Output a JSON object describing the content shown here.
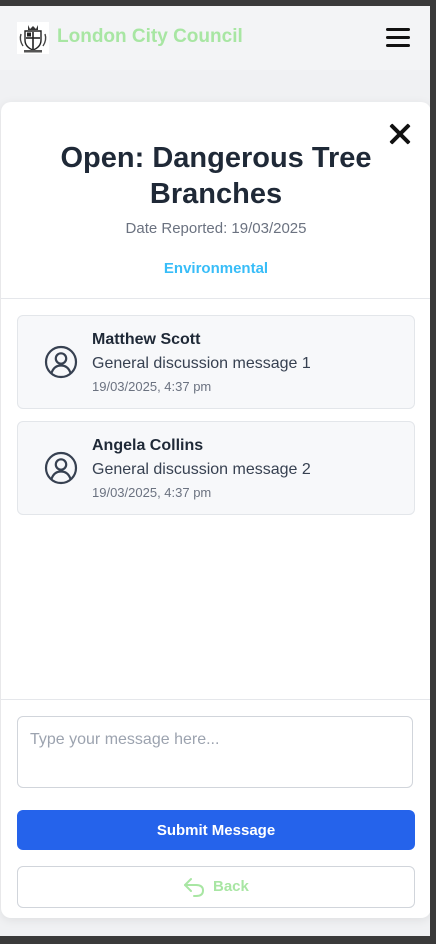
{
  "header": {
    "brand": "London City Council",
    "logo_icon": "crest-icon",
    "menu_icon": "hamburger-menu-icon"
  },
  "modal": {
    "close_icon": "close-icon",
    "title": "Open: Dangerous Tree Branches",
    "date_reported": "Date Reported: 19/03/2025",
    "category": "Environmental",
    "messages": [
      {
        "author": "Matthew Scott",
        "text": "General discussion message 1",
        "time": "19/03/2025, 4:37 pm",
        "avatar_icon": "user-circle-icon"
      },
      {
        "author": "Angela Collins",
        "text": "General discussion message 2",
        "time": "19/03/2025, 4:37 pm",
        "avatar_icon": "user-circle-icon"
      }
    ],
    "composer": {
      "placeholder": "Type your message here...",
      "value": ""
    },
    "submit_label": "Submit Message",
    "back_label": "Back",
    "back_icon": "undo-arrow-icon"
  },
  "colors": {
    "brand": "#a8e6a3",
    "category": "#38bdf8",
    "primary_button": "#2563eb",
    "title": "#1f2937"
  }
}
